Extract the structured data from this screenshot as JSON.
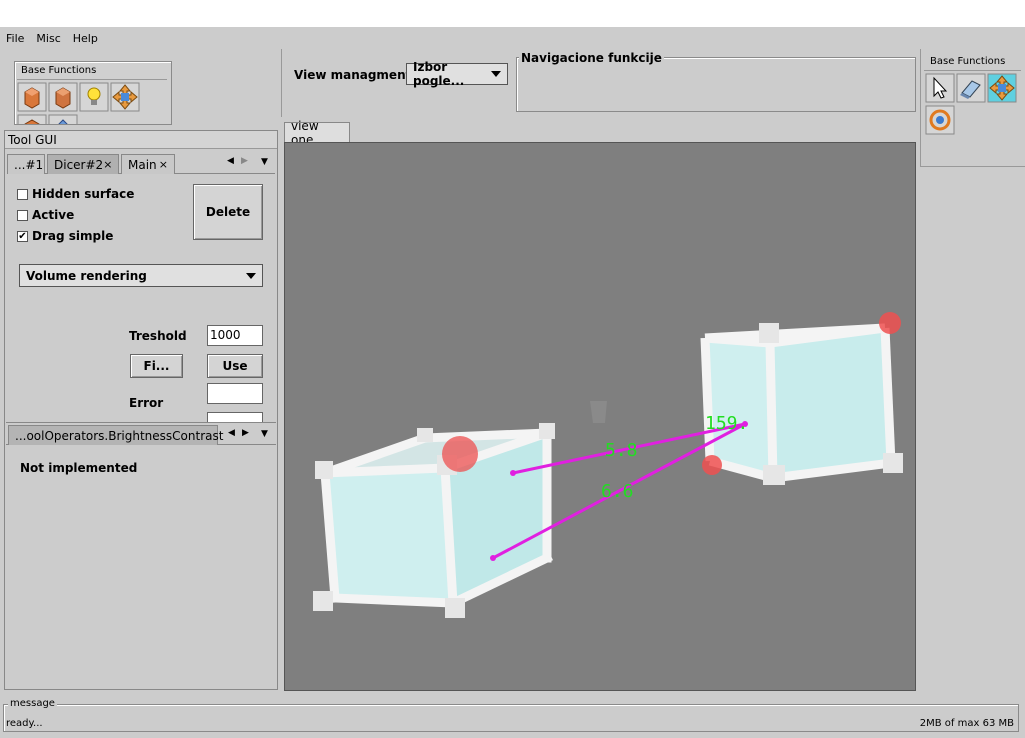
{
  "menu": {
    "file": "File",
    "misc": "Misc",
    "help": "Help"
  },
  "base_functions_left": {
    "title": "Base Functions"
  },
  "base_functions_right": {
    "title": "Base Functions"
  },
  "tool_gui": {
    "title": "Tool GUI",
    "tabs": [
      "...#1",
      "Dicer#2",
      "Main"
    ],
    "checkboxes": [
      {
        "label": "Hidden surface",
        "checked": false
      },
      {
        "label": "Active",
        "checked": false
      },
      {
        "label": "Drag simple",
        "checked": true
      }
    ],
    "delete_label": "Delete",
    "render_mode": "Volume rendering",
    "threshold_label": "Treshold",
    "threshold_value": "1000",
    "fit_label": "Fi...",
    "use_label": "Use",
    "error_label": "Error",
    "error_value": "",
    "check_mark": "✔"
  },
  "operators_panel": {
    "tab": "...oolOperators.BrightnessContrast",
    "message": "Not implemented"
  },
  "view_management": {
    "label": "View managment",
    "selected": "Izbor pogle...",
    "nav_title": "Navigacione funkcije"
  },
  "viewport": {
    "tab": "view one",
    "measurements": [
      "5.8",
      "6.6",
      "159."
    ]
  },
  "status": {
    "group_title": "message",
    "text": "ready...",
    "memory": "2MB of max 63 MB"
  },
  "colors": {
    "background": "#cccccc",
    "viewport_bg": "#7f7f7f",
    "measure_line": "#e020e0",
    "measure_text": "#22dd22",
    "box_fill": "#d8fcfc"
  }
}
